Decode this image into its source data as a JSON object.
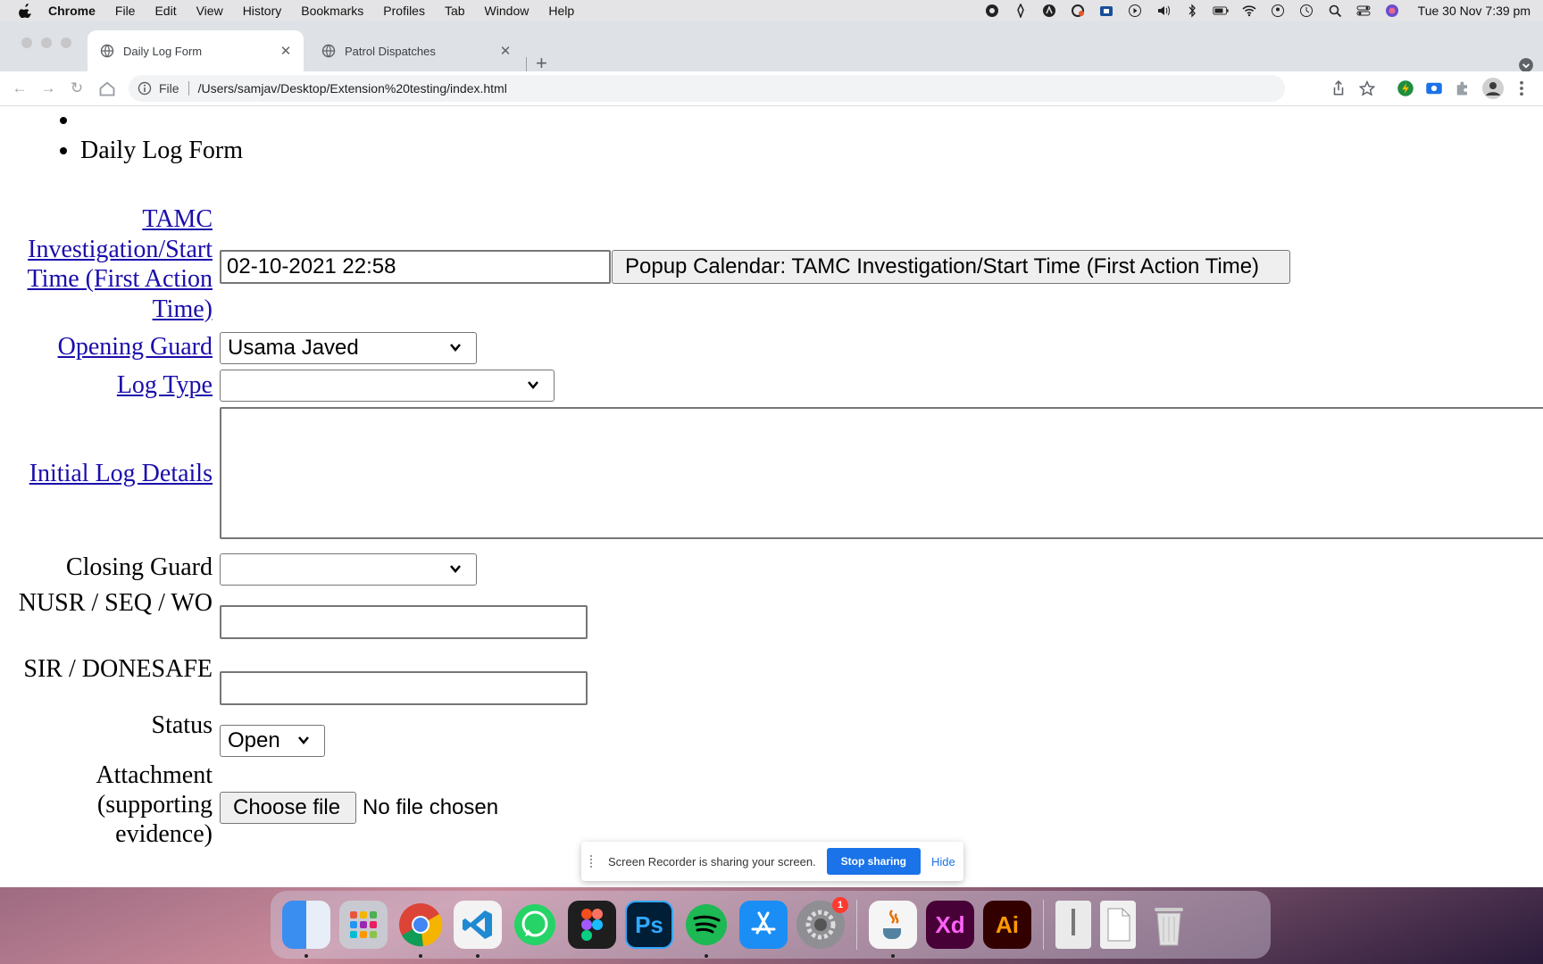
{
  "menubar": {
    "app": "Chrome",
    "items": [
      "File",
      "Edit",
      "View",
      "History",
      "Bookmarks",
      "Profiles",
      "Tab",
      "Window",
      "Help"
    ],
    "clock": "Tue 30 Nov  7:39 pm"
  },
  "browser": {
    "tabs": [
      {
        "title": "Daily Log Form",
        "active": true
      },
      {
        "title": "Patrol Dispatches",
        "active": false
      }
    ],
    "omnibox": {
      "scheme": "File",
      "url": "/Users/samjav/Desktop/Extension%20testing/index.html"
    }
  },
  "page": {
    "bullets": [
      "",
      "Daily Log Form"
    ],
    "form": {
      "tamc_label": "TAMC Investigation/Start Time (First Action Time)",
      "tamc_value": "02-10-2021 22:58",
      "popup_button": "Popup Calendar: TAMC Investigation/Start Time (First Action Time)",
      "opening_guard_label": "Opening Guard",
      "opening_guard_value": "Usama Javed",
      "log_type_label": "Log Type",
      "log_type_value": "",
      "initial_log_label": "Initial Log Details",
      "closing_guard_label": "Closing Guard",
      "closing_guard_value": "",
      "nusr_label": "NUSR / SEQ / WO",
      "nusr_value": "",
      "sir_label": "SIR / DONESAFE",
      "sir_value": "",
      "status_label": "Status",
      "status_value": "Open",
      "attachment_label": "Attachment (supporting evidence)",
      "choose_file": "Choose file",
      "no_file": "No file chosen"
    }
  },
  "sharebar": {
    "message": "Screen Recorder is sharing your screen.",
    "stop": "Stop sharing",
    "hide": "Hide"
  },
  "dock": {
    "icons": [
      "finder-icon",
      "launchpad-icon",
      "chrome-icon",
      "vscode-icon",
      "whatsapp-icon",
      "figma-icon",
      "photoshop-icon",
      "spotify-icon",
      "app-store-icon",
      "system-preferences-icon",
      "java-icon",
      "xd-icon",
      "illustrator-icon",
      "zip-file-icon",
      "htm-file-icon",
      "trash-icon"
    ],
    "ps_label": "Ps",
    "xd_label": "Xd",
    "ai_label": "Ai",
    "settings_badge": "1"
  }
}
